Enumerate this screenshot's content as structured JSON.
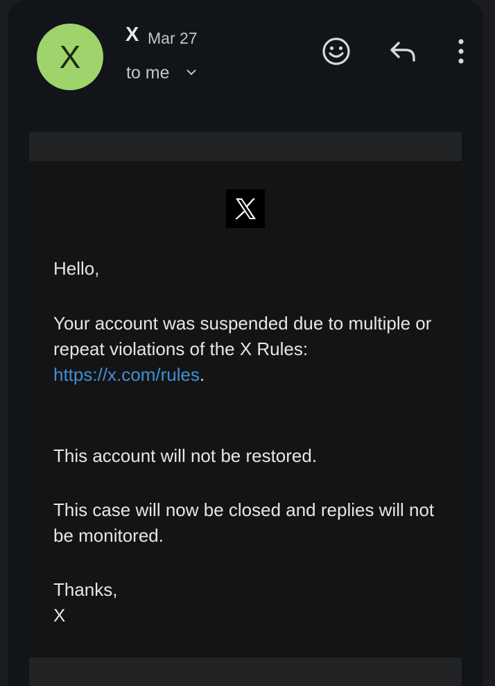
{
  "header": {
    "avatar_letter": "X",
    "sender": "X",
    "date": "Mar 27",
    "recipient": "to me",
    "icons": {
      "recipient_toggle": "chevron-down-icon",
      "emoji": "emoji-smile-icon",
      "reply": "reply-icon",
      "more": "more-vert-icon"
    }
  },
  "email": {
    "logo": "X logo",
    "greeting": "Hello,",
    "suspension_text": "Your account was suspended due to multiple or repeat violations of the X Rules:",
    "rules_link": "https://x.com/rules",
    "link_suffix": ".",
    "restore_text": "This account will not be restored.",
    "case_text": "This case will now be closed and replies will not be monitored.",
    "closing": "Thanks,",
    "signature": "X"
  },
  "colors": {
    "avatar": "#9fd36b",
    "link": "#3f8fd6",
    "background": "#111418"
  }
}
